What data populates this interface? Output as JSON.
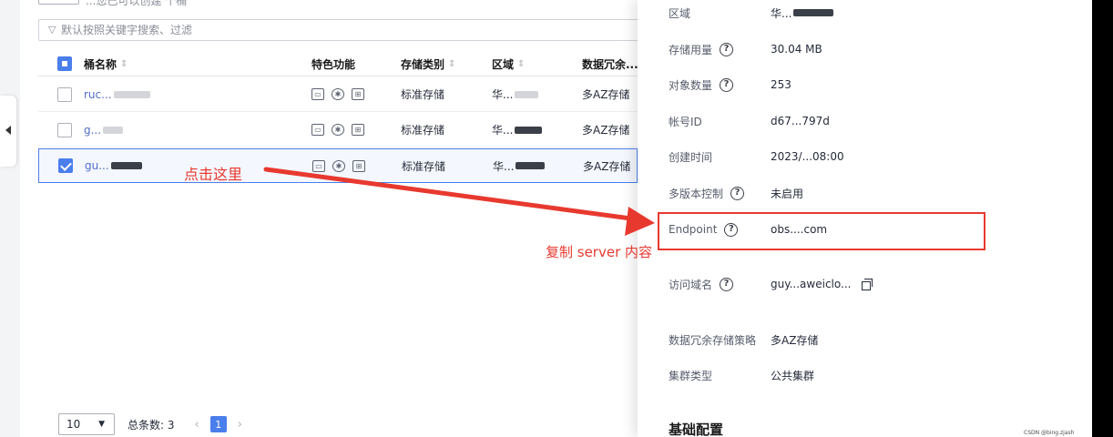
{
  "toolbar": {
    "partial_text": "...您已可以创建 个桶"
  },
  "search": {
    "placeholder": "默认按照关键字搜索、过滤"
  },
  "table": {
    "headers": [
      "桶名称",
      "特色功能",
      "存储类别",
      "区域",
      "数据冗余..."
    ],
    "rows": [
      {
        "name": "ruc...",
        "storage_class": "标准存储",
        "region": "华...",
        "redundancy": "多AZ存储",
        "checked": false
      },
      {
        "name": "g...",
        "storage_class": "标准存储",
        "region": "华...",
        "redundancy": "多AZ存储",
        "checked": false
      },
      {
        "name": "gu...",
        "storage_class": "标准存储",
        "region": "华...",
        "redundancy": "多AZ存储",
        "checked": true
      }
    ]
  },
  "annotations": {
    "click_here": "点击这里",
    "copy_server": "复制 server 内容"
  },
  "pagination": {
    "page_size": "10",
    "total": "总条数: 3",
    "current_page": "1"
  },
  "details": {
    "region": {
      "label": "区域",
      "value": "华..."
    },
    "storage_used": {
      "label": "存储用量",
      "value": "30.04 MB"
    },
    "object_count": {
      "label": "对象数量",
      "value": "253"
    },
    "account_id": {
      "label": "帐号ID",
      "value": "d67...797d"
    },
    "created": {
      "label": "创建时间",
      "value": "2023/...08:00"
    },
    "versioning": {
      "label": "多版本控制",
      "value": "未启用"
    },
    "endpoint": {
      "label": "Endpoint",
      "value": "obs....com"
    },
    "domain": {
      "label": "访问域名",
      "value": "guy...aweiclo..."
    },
    "redundancy_policy": {
      "label": "数据冗余存储策略",
      "value": "多AZ存储"
    },
    "cluster_type": {
      "label": "集群类型",
      "value": "公共集群"
    },
    "section_basic": "基础配置"
  },
  "watermark": "CSDN @bing.zjash",
  "colors": {
    "accent": "#4a7eec",
    "annotation_red": "#e8392f"
  }
}
